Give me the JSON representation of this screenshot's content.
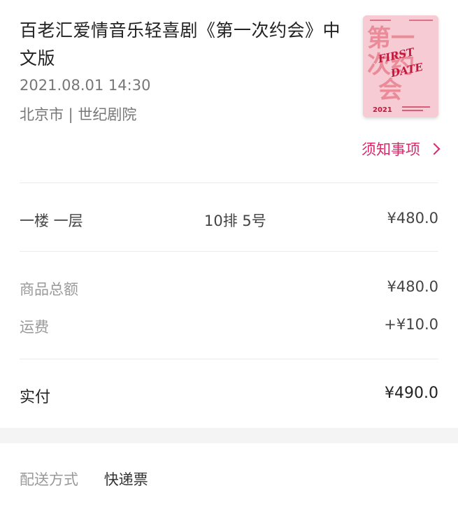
{
  "show": {
    "title": "百老汇爱情音乐轻喜剧《第一次约会》中文版",
    "datetime": "2021.08.01 14:30",
    "venue": "北京市 | 世纪剧院",
    "poster_icon": "poster-image",
    "notice_label": "须知事项"
  },
  "seat": {
    "floor": "一楼 一层",
    "position": "10排 5号",
    "price": "¥480.0"
  },
  "amounts": {
    "subtotal_label": "商品总额",
    "subtotal_value": "¥480.0",
    "shipping_label": "运费",
    "shipping_value": "+¥10.0"
  },
  "paid": {
    "label": "实付",
    "value": "¥490.0"
  },
  "delivery": {
    "label": "配送方式",
    "value": "快递票"
  },
  "colors": {
    "accent": "#d8286a",
    "muted_text": "#999999",
    "divider": "#ececec",
    "band": "#f4f4f4"
  }
}
